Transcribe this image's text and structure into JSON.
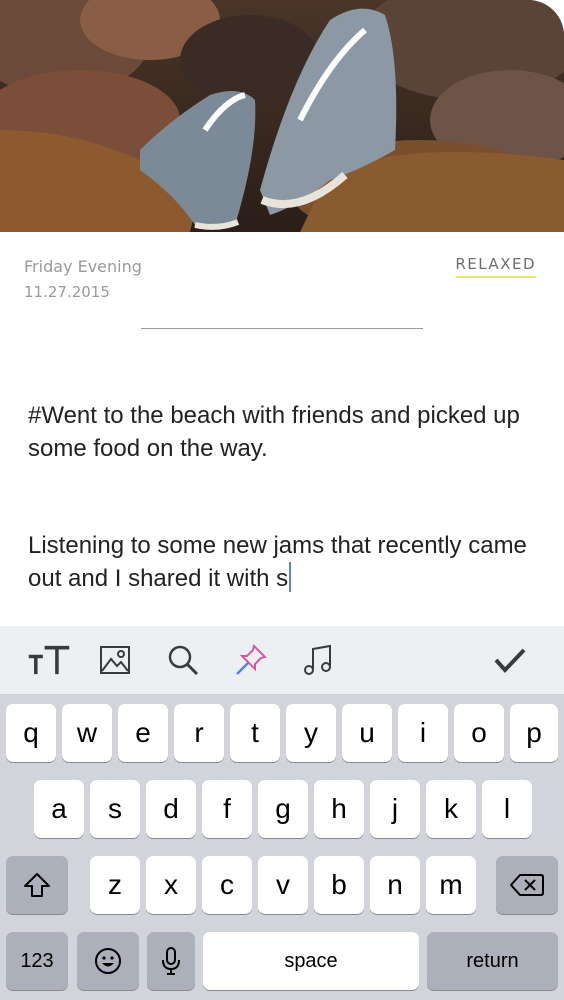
{
  "entry": {
    "day": "Friday Evening",
    "date": "11.27.2015",
    "mood": "RELAXED",
    "paragraph1": "#Went to the beach with friends and picked up some food on the way.",
    "paragraph2": "Listening to some new jams that recently came out and I shared it with s"
  },
  "toolbar": {
    "items": [
      "text-size-icon",
      "image-icon",
      "search-icon",
      "pin-icon",
      "music-note-icon",
      "checkmark-icon"
    ]
  },
  "keyboard": {
    "row1": [
      "q",
      "w",
      "e",
      "r",
      "t",
      "y",
      "u",
      "i",
      "o",
      "p"
    ],
    "row2": [
      "a",
      "s",
      "d",
      "f",
      "g",
      "h",
      "j",
      "k",
      "l"
    ],
    "row3": [
      "z",
      "x",
      "c",
      "v",
      "b",
      "n",
      "m"
    ],
    "numbers_label": "123",
    "space_label": "space",
    "return_label": "return",
    "colors": {
      "background": "#d1d5db",
      "key": "#ffffff",
      "dark_key": "#abb0ba"
    }
  }
}
